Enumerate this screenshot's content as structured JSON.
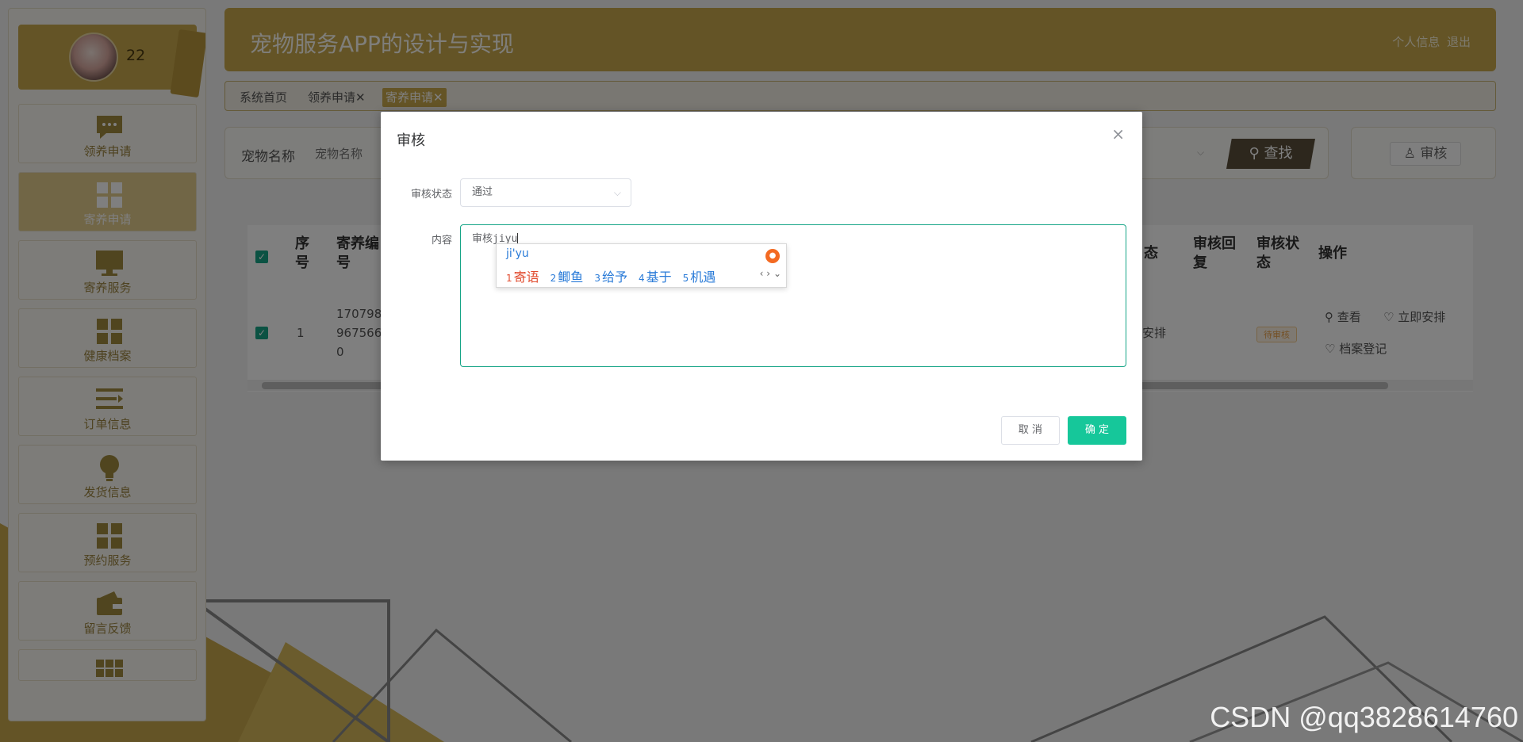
{
  "app": {
    "title": "宠物服务APP的设计与实现"
  },
  "header": {
    "profile_link": "个人信息",
    "logout_link": "退出"
  },
  "user": {
    "name": "22"
  },
  "sidebar": {
    "items": [
      {
        "label": "领养申请",
        "icon": "chat-icon",
        "active": false
      },
      {
        "label": "寄养申请",
        "icon": "grid-icon",
        "active": true
      },
      {
        "label": "寄养服务",
        "icon": "monitor-icon",
        "active": false
      },
      {
        "label": "健康档案",
        "icon": "grid-icon",
        "active": false
      },
      {
        "label": "订单信息",
        "icon": "list-icon",
        "active": false
      },
      {
        "label": "发货信息",
        "icon": "bulb-icon",
        "active": false
      },
      {
        "label": "预约服务",
        "icon": "grid-icon",
        "active": false
      },
      {
        "label": "留言反馈",
        "icon": "wallet-icon",
        "active": false
      }
    ]
  },
  "tabs": [
    {
      "label": "系统首页",
      "closable": false,
      "active": false
    },
    {
      "label": "领养申请",
      "closable": true,
      "active": false
    },
    {
      "label": "寄养申请",
      "closable": true,
      "active": true
    }
  ],
  "search": {
    "label": "宠物名称",
    "placeholder": "宠物名称",
    "button": "查找",
    "audit_button": "审核"
  },
  "table": {
    "headers": {
      "index": "序号",
      "number": "寄养编号",
      "status_partial": "态",
      "reply": "审核回复",
      "audit_status": "审核状态",
      "actions": "操作"
    },
    "row": {
      "index": "1",
      "number_lines": [
        "170798",
        "967566",
        "0"
      ],
      "status_partial": "安排",
      "badge": "待审核",
      "action_view": "查看",
      "action_arrange": "立即安排",
      "action_archive": "档案登记"
    }
  },
  "dialog": {
    "title": "审核",
    "status_label": "审核状态",
    "status_value": "通过",
    "content_label": "内容",
    "content_value": "审核jiyu",
    "cancel": "取 消",
    "confirm": "确 定"
  },
  "ime": {
    "pinyin": "ji'yu",
    "candidates": [
      {
        "n": "1",
        "text": "寄语"
      },
      {
        "n": "2",
        "text": "鲫鱼"
      },
      {
        "n": "3",
        "text": "给予"
      },
      {
        "n": "4",
        "text": "基于"
      },
      {
        "n": "5",
        "text": "机遇"
      }
    ]
  },
  "watermark": "CSDN @qq3828614760",
  "colors": {
    "accent": "#c9a84c",
    "primary": "#16c79a",
    "checkbox": "#16a587"
  }
}
